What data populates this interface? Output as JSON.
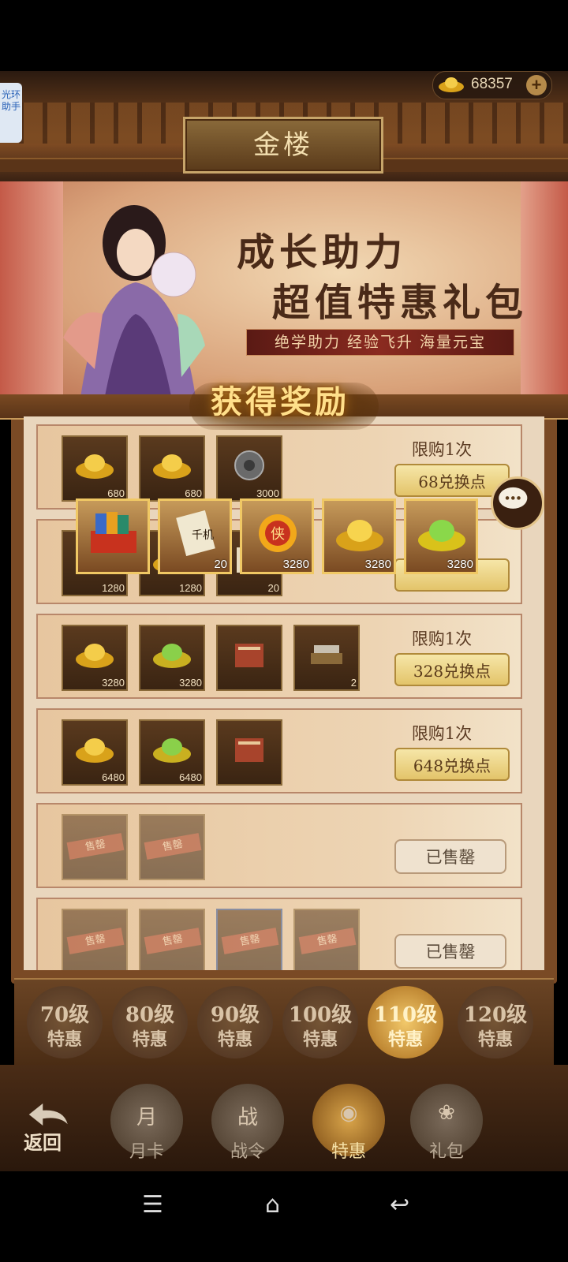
{
  "currency": {
    "amount": "68357",
    "plus": "+"
  },
  "helper": {
    "label": "光环助手"
  },
  "header": {
    "title": "金楼"
  },
  "banner": {
    "headline1": "成长助力",
    "headline2": "超值特惠礼包",
    "subtitle": "绝学助力 经验飞升 海量元宝"
  },
  "popup": {
    "title": "获得奖励",
    "items": [
      {
        "icon": "card-chest-icon",
        "qty": ""
      },
      {
        "icon": "qianji-scroll-icon",
        "qty": "20"
      },
      {
        "icon": "xia-token-icon",
        "qty": "3280"
      },
      {
        "icon": "gold-ingot-icon",
        "qty": "3280"
      },
      {
        "icon": "jade-ingot-icon",
        "qty": "3280"
      }
    ]
  },
  "rows": [
    {
      "items": [
        {
          "icon": "gold-ingot-icon",
          "qty": "680"
        },
        {
          "icon": "gold-ingot-icon",
          "qty": "680"
        },
        {
          "icon": "jade-disc-icon",
          "qty": "3000"
        }
      ],
      "limit": "限购1次",
      "button": "68兑换点",
      "sold": false
    },
    {
      "items": [
        {
          "icon": "gold-ingot-icon",
          "qty": "1280"
        },
        {
          "icon": "gold-ingot-icon",
          "qty": "1280"
        },
        {
          "icon": "scroll-icon",
          "qty": "20"
        }
      ],
      "limit": "",
      "button": "",
      "sold": false
    },
    {
      "items": [
        {
          "icon": "gold-ingot-icon",
          "qty": "3280"
        },
        {
          "icon": "jade-ingot-icon",
          "qty": "3280"
        },
        {
          "icon": "book-stack-icon",
          "qty": ""
        },
        {
          "icon": "scroll-table-icon",
          "qty": "2"
        }
      ],
      "limit": "限购1次",
      "button": "328兑换点",
      "sold": false
    },
    {
      "items": [
        {
          "icon": "gold-ingot-icon",
          "qty": "6480"
        },
        {
          "icon": "jade-ingot-icon",
          "qty": "6480"
        },
        {
          "icon": "book-stack-icon",
          "qty": ""
        }
      ],
      "limit": "限购1次",
      "button": "648兑换点",
      "sold": false
    },
    {
      "items": [
        {
          "icon": "sold-item-icon",
          "qty": "",
          "tag": "售罄"
        },
        {
          "icon": "sold-item-icon",
          "qty": "",
          "tag": "售罄"
        }
      ],
      "limit": "",
      "button": "已售罄",
      "sold": true
    },
    {
      "items": [
        {
          "icon": "sold-item-icon",
          "qty": "",
          "tag": "售罄"
        },
        {
          "icon": "sold-item-icon",
          "qty": "",
          "tag": "售罄"
        },
        {
          "icon": "sold-item-icon",
          "qty": "",
          "tag": "售罄"
        },
        {
          "icon": "sold-item-icon",
          "qty": "",
          "tag": "售罄"
        }
      ],
      "limit": "",
      "button": "已售罄",
      "sold": true
    }
  ],
  "tiers": [
    {
      "level": "70级",
      "label": "特惠"
    },
    {
      "level": "80级",
      "label": "特惠"
    },
    {
      "level": "90级",
      "label": "特惠"
    },
    {
      "level": "100级",
      "label": "特惠"
    },
    {
      "level": "110级",
      "label": "特惠",
      "active": true
    },
    {
      "level": "120级",
      "label": "特惠"
    }
  ],
  "nav": {
    "back": "返回",
    "tabs": [
      {
        "label": "月卡",
        "glyph": "月"
      },
      {
        "label": "战令",
        "glyph": "战"
      },
      {
        "label": "特惠",
        "glyph": "◉",
        "active": true
      },
      {
        "label": "礼包",
        "glyph": "❀"
      }
    ]
  },
  "system_nav": {
    "menu": "☰",
    "home": "⌂",
    "back": "↩"
  }
}
